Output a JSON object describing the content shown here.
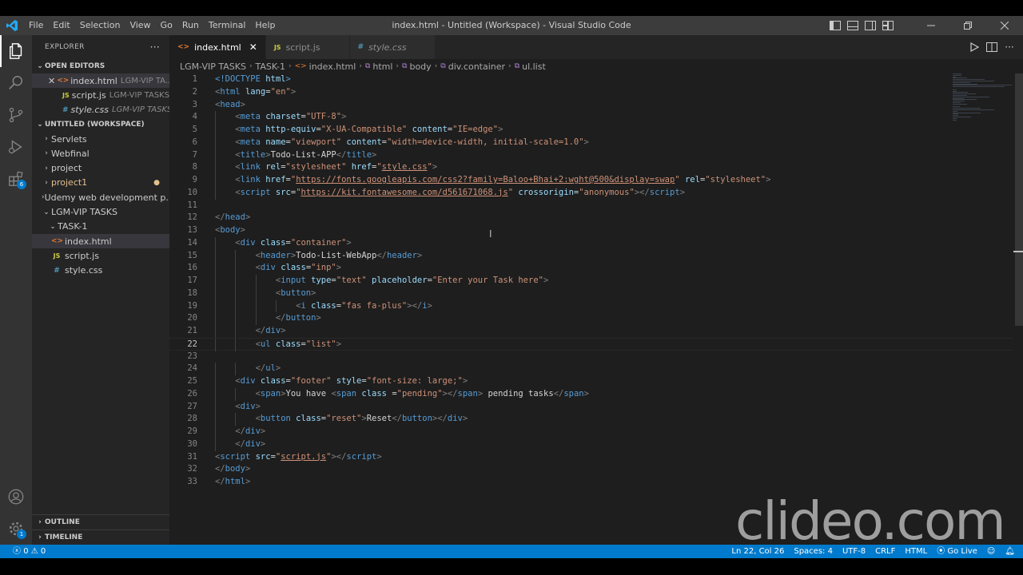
{
  "window": {
    "title": "index.html - Untitled (Workspace) - Visual Studio Code",
    "menu": [
      "File",
      "Edit",
      "Selection",
      "View",
      "Go",
      "Run",
      "Terminal",
      "Help"
    ]
  },
  "activitybar": {
    "extensions_badge": "6",
    "settings_badge": "1"
  },
  "sidebar": {
    "header": "EXPLORER",
    "more": "···",
    "open_editors": {
      "title": "OPEN EDITORS",
      "items": [
        {
          "name": "index.html",
          "desc": "LGM-VIP TA..."
        },
        {
          "name": "script.js",
          "desc": "LGM-VIP TASKS ..."
        },
        {
          "name": "style.css",
          "desc": "LGM-VIP TASKS ..."
        }
      ]
    },
    "workspace": {
      "title": "UNTITLED (WORKSPACE)",
      "folders": [
        "Servlets",
        "Webfinal",
        "project",
        "project1",
        "Udemy web development p...",
        "LGM-VIP TASKS"
      ],
      "task_folder": "TASK-1",
      "files": [
        "index.html",
        "script.js",
        "style.css"
      ]
    },
    "outline": "OUTLINE",
    "timeline": "TIMELINE"
  },
  "tabs": [
    {
      "label": "index.html",
      "icon": "<>"
    },
    {
      "label": "script.js",
      "icon": "JS"
    },
    {
      "label": "style.css",
      "icon": "#"
    }
  ],
  "breadcrumb": [
    "LGM-VIP TASKS",
    "TASK-1",
    "index.html",
    "html",
    "body",
    "div.container",
    "ul.list"
  ],
  "code": [
    [
      [
        "tg",
        "<!DOCTYPE "
      ],
      [
        "at",
        "html"
      ],
      [
        "tg",
        ">"
      ]
    ],
    [
      [
        "br",
        "<"
      ],
      [
        "tg",
        "html "
      ],
      [
        "at",
        "lang"
      ],
      [
        "tx",
        "="
      ],
      [
        "st",
        "\"en\""
      ],
      [
        "br",
        ">"
      ]
    ],
    [
      [
        "br",
        "<"
      ],
      [
        "tg",
        "head"
      ],
      [
        "br",
        ">"
      ]
    ],
    [
      [
        "tx",
        "    "
      ],
      [
        "br",
        "<"
      ],
      [
        "tg",
        "meta "
      ],
      [
        "at",
        "charset"
      ],
      [
        "tx",
        "="
      ],
      [
        "st",
        "\"UTF-8\""
      ],
      [
        "br",
        ">"
      ]
    ],
    [
      [
        "tx",
        "    "
      ],
      [
        "br",
        "<"
      ],
      [
        "tg",
        "meta "
      ],
      [
        "at",
        "http-equiv"
      ],
      [
        "tx",
        "="
      ],
      [
        "st",
        "\"X-UA-Compatible\""
      ],
      [
        "tx",
        " "
      ],
      [
        "at",
        "content"
      ],
      [
        "tx",
        "="
      ],
      [
        "st",
        "\"IE=edge\""
      ],
      [
        "br",
        ">"
      ]
    ],
    [
      [
        "tx",
        "    "
      ],
      [
        "br",
        "<"
      ],
      [
        "tg",
        "meta "
      ],
      [
        "at",
        "name"
      ],
      [
        "tx",
        "="
      ],
      [
        "st",
        "\"viewport\""
      ],
      [
        "tx",
        " "
      ],
      [
        "at",
        "content"
      ],
      [
        "tx",
        "="
      ],
      [
        "st",
        "\"width=device-width, initial-scale=1.0\""
      ],
      [
        "br",
        ">"
      ]
    ],
    [
      [
        "tx",
        "    "
      ],
      [
        "br",
        "<"
      ],
      [
        "tg",
        "title"
      ],
      [
        "br",
        ">"
      ],
      [
        "tx",
        "Todo-List-APP"
      ],
      [
        "br",
        "</"
      ],
      [
        "tg",
        "title"
      ],
      [
        "br",
        ">"
      ]
    ],
    [
      [
        "tx",
        "    "
      ],
      [
        "br",
        "<"
      ],
      [
        "tg",
        "link "
      ],
      [
        "at",
        "rel"
      ],
      [
        "tx",
        "="
      ],
      [
        "st",
        "\"stylesheet\""
      ],
      [
        "tx",
        " "
      ],
      [
        "at",
        "href"
      ],
      [
        "tx",
        "="
      ],
      [
        "st",
        "\""
      ],
      [
        "stl",
        "style.css"
      ],
      [
        "st",
        "\""
      ],
      [
        "br",
        ">"
      ]
    ],
    [
      [
        "tx",
        "    "
      ],
      [
        "br",
        "<"
      ],
      [
        "tg",
        "link "
      ],
      [
        "at",
        "href"
      ],
      [
        "tx",
        "="
      ],
      [
        "st",
        "\""
      ],
      [
        "stl",
        "https://fonts.googleapis.com/css2?family=Baloo+Bhai+2:wght@500&display=swap"
      ],
      [
        "st",
        "\""
      ],
      [
        "tx",
        " "
      ],
      [
        "at",
        "rel"
      ],
      [
        "tx",
        "="
      ],
      [
        "st",
        "\"stylesheet\""
      ],
      [
        "br",
        ">"
      ]
    ],
    [
      [
        "tx",
        "    "
      ],
      [
        "br",
        "<"
      ],
      [
        "tg",
        "script "
      ],
      [
        "at",
        "src"
      ],
      [
        "tx",
        "="
      ],
      [
        "st",
        "\""
      ],
      [
        "stl",
        "https://kit.fontawesome.com/d561671068.js"
      ],
      [
        "st",
        "\""
      ],
      [
        "tx",
        " "
      ],
      [
        "at",
        "crossorigin"
      ],
      [
        "tx",
        "="
      ],
      [
        "st",
        "\"anonymous\""
      ],
      [
        "br",
        "></"
      ],
      [
        "tg",
        "script"
      ],
      [
        "br",
        ">"
      ]
    ],
    [],
    [
      [
        "br",
        "</"
      ],
      [
        "tg",
        "head"
      ],
      [
        "br",
        ">"
      ]
    ],
    [
      [
        "br",
        "<"
      ],
      [
        "tg",
        "body"
      ],
      [
        "br",
        ">"
      ]
    ],
    [
      [
        "tx",
        "    "
      ],
      [
        "br",
        "<"
      ],
      [
        "tg",
        "div "
      ],
      [
        "at",
        "class"
      ],
      [
        "tx",
        "="
      ],
      [
        "st",
        "\"container\""
      ],
      [
        "br",
        ">"
      ]
    ],
    [
      [
        "tx",
        "        "
      ],
      [
        "br",
        "<"
      ],
      [
        "tg",
        "header"
      ],
      [
        "br",
        ">"
      ],
      [
        "tx",
        "Todo-List-WebApp"
      ],
      [
        "br",
        "</"
      ],
      [
        "tg",
        "header"
      ],
      [
        "br",
        ">"
      ]
    ],
    [
      [
        "tx",
        "        "
      ],
      [
        "br",
        "<"
      ],
      [
        "tg",
        "div "
      ],
      [
        "at",
        "class"
      ],
      [
        "tx",
        "="
      ],
      [
        "st",
        "\"inp\""
      ],
      [
        "br",
        ">"
      ]
    ],
    [
      [
        "tx",
        "            "
      ],
      [
        "br",
        "<"
      ],
      [
        "tg",
        "input "
      ],
      [
        "at",
        "type"
      ],
      [
        "tx",
        "="
      ],
      [
        "st",
        "\"text\""
      ],
      [
        "tx",
        " "
      ],
      [
        "at",
        "placeholder"
      ],
      [
        "tx",
        "="
      ],
      [
        "st",
        "\"Enter your Task here\""
      ],
      [
        "br",
        ">"
      ]
    ],
    [
      [
        "tx",
        "            "
      ],
      [
        "br",
        "<"
      ],
      [
        "tg",
        "button"
      ],
      [
        "br",
        ">"
      ]
    ],
    [
      [
        "tx",
        "                "
      ],
      [
        "br",
        "<"
      ],
      [
        "tg",
        "i "
      ],
      [
        "at",
        "class"
      ],
      [
        "tx",
        "="
      ],
      [
        "st",
        "\"fas fa-plus\""
      ],
      [
        "br",
        "></"
      ],
      [
        "tg",
        "i"
      ],
      [
        "br",
        ">"
      ]
    ],
    [
      [
        "tx",
        "            "
      ],
      [
        "br",
        "</"
      ],
      [
        "tg",
        "button"
      ],
      [
        "br",
        ">"
      ]
    ],
    [
      [
        "tx",
        "        "
      ],
      [
        "br",
        "</"
      ],
      [
        "tg",
        "div"
      ],
      [
        "br",
        ">"
      ]
    ],
    [
      [
        "tx",
        "        "
      ],
      [
        "br",
        "<"
      ],
      [
        "tg",
        "ul "
      ],
      [
        "at",
        "class"
      ],
      [
        "tx",
        "="
      ],
      [
        "st",
        "\"list\""
      ],
      [
        "br",
        ">"
      ]
    ],
    [],
    [
      [
        "tx",
        "        "
      ],
      [
        "br",
        "</"
      ],
      [
        "tg",
        "ul"
      ],
      [
        "br",
        ">"
      ]
    ],
    [
      [
        "tx",
        "    "
      ],
      [
        "br",
        "<"
      ],
      [
        "tg",
        "div "
      ],
      [
        "at",
        "class"
      ],
      [
        "tx",
        "="
      ],
      [
        "st",
        "\"footer\""
      ],
      [
        "tx",
        " "
      ],
      [
        "at",
        "style"
      ],
      [
        "tx",
        "="
      ],
      [
        "st",
        "\"font-size: large;\""
      ],
      [
        "br",
        ">"
      ]
    ],
    [
      [
        "tx",
        "        "
      ],
      [
        "br",
        "<"
      ],
      [
        "tg",
        "span"
      ],
      [
        "br",
        ">"
      ],
      [
        "tx",
        "You have "
      ],
      [
        "br",
        "<"
      ],
      [
        "tg",
        "span "
      ],
      [
        "at",
        "class "
      ],
      [
        "tx",
        "="
      ],
      [
        "st",
        "\"pending\""
      ],
      [
        "br",
        "></"
      ],
      [
        "tg",
        "span"
      ],
      [
        "br",
        ">"
      ],
      [
        "tx",
        " pending tasks"
      ],
      [
        "br",
        "</"
      ],
      [
        "tg",
        "span"
      ],
      [
        "br",
        ">"
      ]
    ],
    [
      [
        "tx",
        "    "
      ],
      [
        "br",
        "<"
      ],
      [
        "tg",
        "div"
      ],
      [
        "br",
        ">"
      ]
    ],
    [
      [
        "tx",
        "        "
      ],
      [
        "br",
        "<"
      ],
      [
        "tg",
        "button "
      ],
      [
        "at",
        "class"
      ],
      [
        "tx",
        "="
      ],
      [
        "st",
        "\"reset\""
      ],
      [
        "br",
        ">"
      ],
      [
        "tx",
        "Reset"
      ],
      [
        "br",
        "</"
      ],
      [
        "tg",
        "button"
      ],
      [
        "br",
        "></"
      ],
      [
        "tg",
        "div"
      ],
      [
        "br",
        ">"
      ]
    ],
    [
      [
        "tx",
        "    "
      ],
      [
        "br",
        "</"
      ],
      [
        "tg",
        "div"
      ],
      [
        "br",
        ">"
      ]
    ],
    [
      [
        "tx",
        "    "
      ],
      [
        "br",
        "</"
      ],
      [
        "tg",
        "div"
      ],
      [
        "br",
        ">"
      ]
    ],
    [
      [
        "br",
        "<"
      ],
      [
        "tg",
        "script "
      ],
      [
        "at",
        "src"
      ],
      [
        "tx",
        "="
      ],
      [
        "st",
        "\""
      ],
      [
        "stl",
        "script.js"
      ],
      [
        "st",
        "\""
      ],
      [
        "br",
        "></"
      ],
      [
        "tg",
        "script"
      ],
      [
        "br",
        ">"
      ]
    ],
    [
      [
        "br",
        "</"
      ],
      [
        "tg",
        "body"
      ],
      [
        "br",
        ">"
      ]
    ],
    [
      [
        "br",
        "</"
      ],
      [
        "tg",
        "html"
      ],
      [
        "br",
        ">"
      ]
    ]
  ],
  "current_line": 22,
  "watermark": "clideo.com",
  "statusbar": {
    "errors": "0",
    "warnings": "0",
    "position": "Ln 22, Col 26",
    "spaces": "Spaces: 4",
    "encoding": "UTF-8",
    "eol": "CRLF",
    "language": "HTML",
    "golive": "Go Live"
  },
  "colors": {
    "statusbar": "#007acc",
    "editor_bg": "#1e1e1e",
    "sidebar_bg": "#252526",
    "activitybar_bg": "#333333",
    "titlebar_bg": "#3c3c3c"
  }
}
